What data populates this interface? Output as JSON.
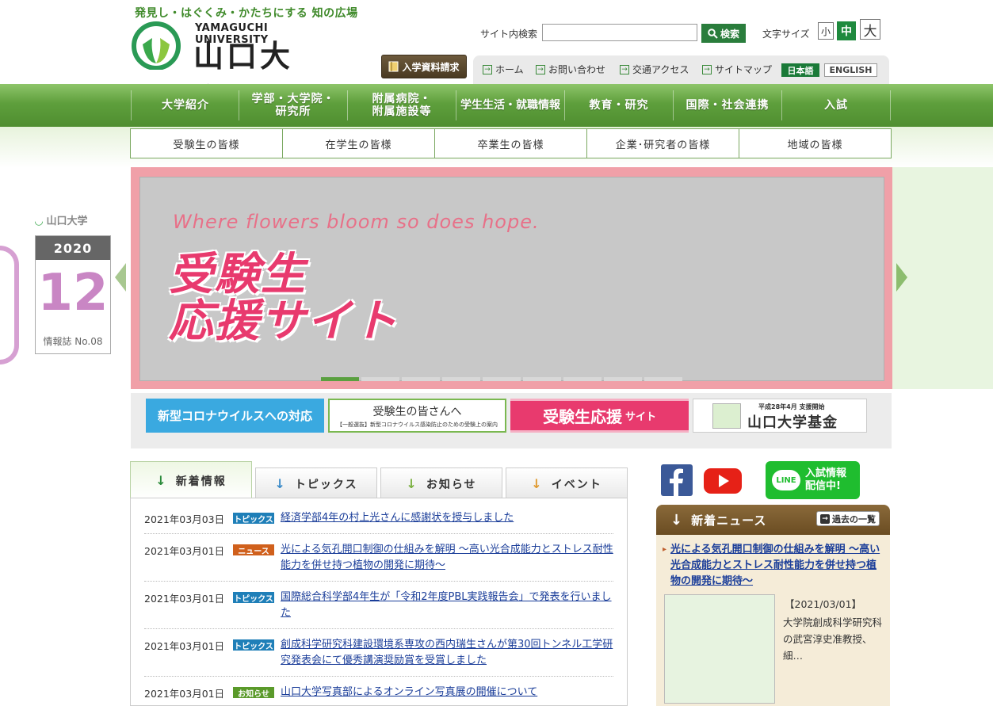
{
  "header": {
    "tagline": "発見し・はぐくみ・かたちにする 知の広場",
    "logo_en": "YAMAGUCHI UNIVERSITY",
    "logo_ja": "山口大学",
    "search_label": "サイト内検索",
    "search_value": "",
    "search_button": "検索",
    "font_size_label": "文字サイズ",
    "font_sizes": [
      "小",
      "中",
      "大"
    ],
    "request_button": "入学資料請求",
    "util_links": [
      "ホーム",
      "お問い合わせ",
      "交通アクセス",
      "サイトマップ"
    ],
    "lang_ja": "日本語",
    "lang_en": "ENGLISH"
  },
  "nav": {
    "items": [
      {
        "line1": "大学紹介",
        "line2": ""
      },
      {
        "line1": "学部・大学院・",
        "line2": "研究所"
      },
      {
        "line1": "附属病院・",
        "line2": "附属施設等"
      },
      {
        "line1": "学生生活・就職情報",
        "line2": ""
      },
      {
        "line1": "教育・研究",
        "line2": ""
      },
      {
        "line1": "国際・社会連携",
        "line2": ""
      },
      {
        "line1": "入試",
        "line2": ""
      }
    ]
  },
  "subnav": [
    "受験生の皆様",
    "在学生の皆様",
    "卒業生の皆様",
    "企業･研究者の皆様",
    "地域の皆様"
  ],
  "hero": {
    "tagline": "Where flowers bloom so does hope.",
    "title_line1": "受験生",
    "title_line2": "応援サイト"
  },
  "calendar": {
    "logo": "山口大学",
    "year": "2020",
    "month": "12",
    "footer": "情報誌 No.08"
  },
  "banners": {
    "covid": "新型コロナウイルスへの対応",
    "exam_title": "受験生の皆さんへ",
    "exam_sub": "【一般選抜】新型コロナウイルス感染防止のための受験上の案内",
    "support_main": "受験生応援",
    "support_sub": "サイト",
    "fund_top": "平成28年4月 支援開始",
    "fund_main": "山口大学基金"
  },
  "tabs": [
    "新着情報",
    "トピックス",
    "お知らせ",
    "イベント"
  ],
  "news": [
    {
      "date": "2021年03月03日",
      "badge": "トピックス",
      "text": "経済学部4年の村上光さんに感謝状を授与しました"
    },
    {
      "date": "2021年03月01日",
      "badge": "ニュース",
      "text": "光による気孔開口制御の仕組みを解明 ～高い光合成能力とストレス耐性能力を併せ持つ植物の開発に期待～"
    },
    {
      "date": "2021年03月01日",
      "badge": "トピックス",
      "text": "国際総合科学部4年生が「令和2年度PBL実践報告会」で発表を行いました"
    },
    {
      "date": "2021年03月01日",
      "badge": "トピックス",
      "text": "創成科学研究科建設環境系専攻の西内瑞生さんが第30回トンネル工学研究発表会にて優秀講演奨励賞を受賞しました"
    },
    {
      "date": "2021年03月01日",
      "badge": "お知らせ",
      "text": "山口大学写真部によるオンライン写真展の開催について"
    }
  ],
  "badge_colors": {
    "トピックス": "#1f7fb8",
    "ニュース": "#d0601c",
    "お知らせ": "#5a9a2a"
  },
  "line_banner": {
    "line": "LINE",
    "text1": "入試情報",
    "text2": "配信中!"
  },
  "news_panel": {
    "title": "新着ニュース",
    "button": "過去の一覧",
    "link": "光による気孔開口制御の仕組みを解明 ～高い光合成能力とストレス耐性能力を併せ持つ植物の開発に期待～",
    "date": "【2021/03/01】",
    "desc": "大学院創成科学研究科の武宮淳史准教授、細…"
  }
}
